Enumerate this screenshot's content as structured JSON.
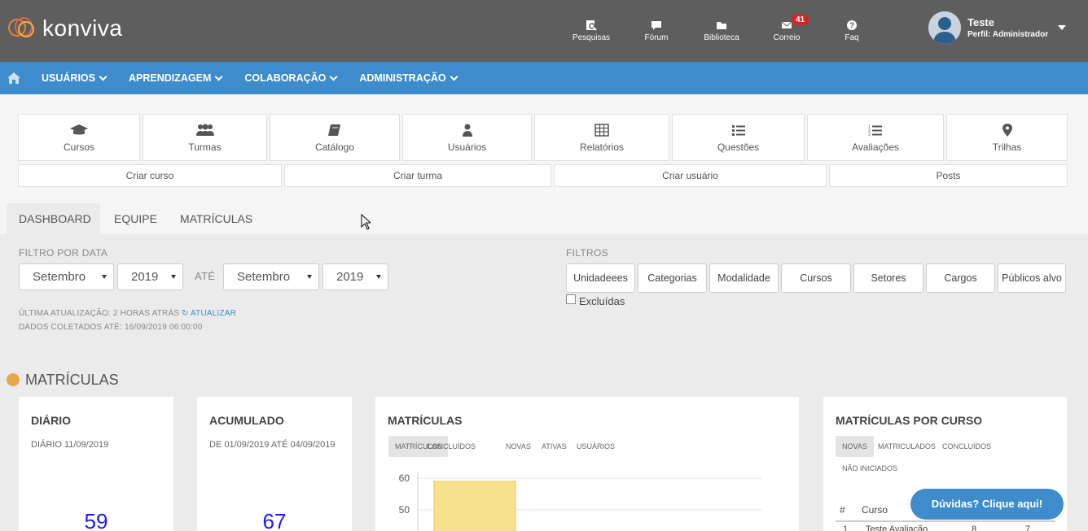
{
  "brand": {
    "logo_text": "konviva"
  },
  "topnav": {
    "items": [
      {
        "label": "Pesquisas",
        "icon": "search-doc-icon"
      },
      {
        "label": "Fórum",
        "icon": "chat-icon"
      },
      {
        "label": "Biblioteca",
        "icon": "folder-icon"
      },
      {
        "label": "Correio",
        "icon": "mail-icon",
        "badge": "41"
      },
      {
        "label": "Faq",
        "icon": "question-icon"
      }
    ]
  },
  "user": {
    "name": "Teste",
    "role": "Perfil: Administrador"
  },
  "mainnav": {
    "items": [
      {
        "label": "USUÁRIOS"
      },
      {
        "label": "APRENDIZAGEM"
      },
      {
        "label": "COLABORAÇÃO"
      },
      {
        "label": "ADMINISTRAÇÃO"
      }
    ]
  },
  "tiles": [
    {
      "label": "Cursos",
      "icon": "graduation-cap-icon"
    },
    {
      "label": "Turmas",
      "icon": "users-group-icon"
    },
    {
      "label": "Catálogo",
      "icon": "book-icon"
    },
    {
      "label": "Usuários",
      "icon": "user-icon"
    },
    {
      "label": "Relatórios",
      "icon": "table-icon"
    },
    {
      "label": "Questões",
      "icon": "list-icon"
    },
    {
      "label": "Avaliações",
      "icon": "ordered-list-icon"
    },
    {
      "label": "Trilhas",
      "icon": "map-marker-icon"
    }
  ],
  "quick_actions": [
    {
      "label": "Criar curso"
    },
    {
      "label": "Criar turma"
    },
    {
      "label": "Criar usuário"
    },
    {
      "label": "Posts"
    }
  ],
  "tabs": [
    {
      "label": "DASHBOARD",
      "active": true
    },
    {
      "label": "EQUIPE",
      "active": false
    },
    {
      "label": "MATRÍCULAS",
      "active": false
    }
  ],
  "date_filter": {
    "label": "FILTRO POR DATA",
    "from_month": "Setembro",
    "from_year": "2019",
    "until_label": "ATÉ",
    "to_month": "Setembro",
    "to_year": "2019"
  },
  "filters": {
    "label": "FILTROS",
    "buttons": [
      "Unidadeees",
      "Categorias",
      "Modalidade",
      "Cursos",
      "Setores",
      "Cargos",
      "Públicos alvo"
    ],
    "excluded_label": "Excluídas"
  },
  "meta": {
    "last_update": "ÚLTIMA ATUALIZAÇÃO: 2 HORAS ATRÁS",
    "refresh_label": "ATUALIZAR",
    "collected": "DADOS COLETADOS ATÉ: 16/09/2019 06:00:00"
  },
  "section": {
    "title": "MATRÍCULAS"
  },
  "cards": {
    "daily": {
      "title": "DIÁRIO",
      "subtitle": "DIÁRIO 11/09/2019",
      "value": "59"
    },
    "accumulated": {
      "title": "ACUMULADO",
      "subtitle": "DE 01/09/2019 ATÉ 04/09/2019",
      "value": "67"
    },
    "enrollments": {
      "title": "MATRÍCULAS",
      "pills": [
        "MATRÍCULAS",
        "CONCLUÍDOS",
        "NOVAS",
        "ATIVAS",
        "USUÁRIOS"
      ]
    },
    "by_course": {
      "title": "MATRÍCULAS POR CURSO",
      "pills": [
        "NOVAS",
        "MATRICULADOS",
        "CONCLUÍDOS",
        "NÃO INICIADOS"
      ],
      "table_headers": [
        "#",
        "Curso"
      ],
      "table_rows": [
        {
          "index": "1",
          "course": "Teste Avaliação",
          "col_a": "8",
          "col_b": "7"
        }
      ]
    }
  },
  "chart_data": {
    "type": "bar",
    "title": "",
    "y_ticks": [
      60,
      50
    ],
    "ylim": [
      0,
      60
    ],
    "categories": [
      ""
    ],
    "series": [
      {
        "values": [
          59
        ]
      }
    ],
    "bar_color": "#f7e08e"
  },
  "help": {
    "label": "Dúvidas? Clique aqui!"
  },
  "colors": {
    "header": "#5e5e5e",
    "nav": "#3f8ccd",
    "badge": "#e02020",
    "number": "#1a1aff"
  }
}
